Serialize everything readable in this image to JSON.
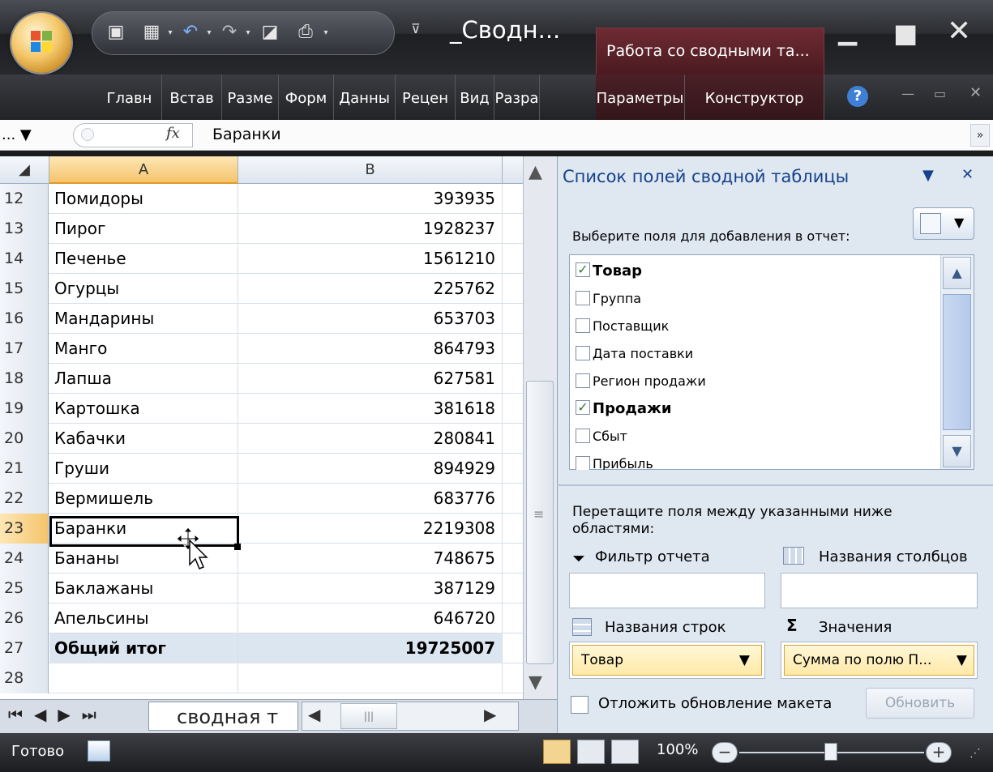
{
  "title_bar": {
    "doc_title": "_Сводн...",
    "context_tab_label": "Работа со сводными та...",
    "minimize_glyph": "▁",
    "restore_glyph": "■",
    "close_glyph": "✕"
  },
  "ribbon_tabs": [
    "Главн",
    "Встав",
    "Разме",
    "Форм",
    "Данны",
    "Рецен",
    "Вид",
    "Разра"
  ],
  "context_tabs": [
    "Параметры",
    "Конструктор"
  ],
  "ribbon_help_glyph": "?",
  "formula_bar": {
    "name_box": "...",
    "fx_label": "fx",
    "content": "Баранки",
    "expand_glyph": "»"
  },
  "columns": [
    "A",
    "B"
  ],
  "rows": [
    {
      "num": "12",
      "name": "Помидоры",
      "value": "393935"
    },
    {
      "num": "13",
      "name": "Пирог",
      "value": "1928237"
    },
    {
      "num": "14",
      "name": "Печенье",
      "value": "1561210"
    },
    {
      "num": "15",
      "name": "Огурцы",
      "value": "225762"
    },
    {
      "num": "16",
      "name": "Мандарины",
      "value": "653703"
    },
    {
      "num": "17",
      "name": "Манго",
      "value": "864793"
    },
    {
      "num": "18",
      "name": "Лапша",
      "value": "627581"
    },
    {
      "num": "19",
      "name": "Картошка",
      "value": "381618"
    },
    {
      "num": "20",
      "name": "Кабачки",
      "value": "280841"
    },
    {
      "num": "21",
      "name": "Груши",
      "value": "894929"
    },
    {
      "num": "22",
      "name": "Вермишель",
      "value": "683776"
    },
    {
      "num": "23",
      "name": "Баранки",
      "value": "2219308"
    },
    {
      "num": "24",
      "name": "Бананы",
      "value": "748675"
    },
    {
      "num": "25",
      "name": "Баклажаны",
      "value": "387129"
    },
    {
      "num": "26",
      "name": "Апельсины",
      "value": "646720"
    },
    {
      "num": "27",
      "name": "Общий итог",
      "value": "19725007"
    },
    {
      "num": "28",
      "name": "",
      "value": ""
    }
  ],
  "sheet_tab": "сводная т",
  "status": {
    "ready": "Готово",
    "zoom": "100%"
  },
  "pivot_pane": {
    "title": "Список полей сводной таблицы",
    "instruction": "Выберите поля для добавления в отчет:",
    "fields": [
      {
        "label": "Товар",
        "checked": true
      },
      {
        "label": "Группа",
        "checked": false
      },
      {
        "label": "Поставщик",
        "checked": false
      },
      {
        "label": "Дата поставки",
        "checked": false
      },
      {
        "label": "Регион продажи",
        "checked": false
      },
      {
        "label": "Продажи",
        "checked": true
      },
      {
        "label": "Сбыт",
        "checked": false
      },
      {
        "label": "Прибыль",
        "checked": false
      }
    ],
    "drag_instruction": "Перетащите поля между указанными ниже областями:",
    "report_filter": "Фильтр отчета",
    "column_labels": "Названия столбцов",
    "row_labels": "Названия строк",
    "values": "Значения",
    "row_field": "Товар",
    "value_field": "Сумма по полю П...",
    "defer_update": "Отложить обновление макета",
    "update_button": "Обновить"
  }
}
